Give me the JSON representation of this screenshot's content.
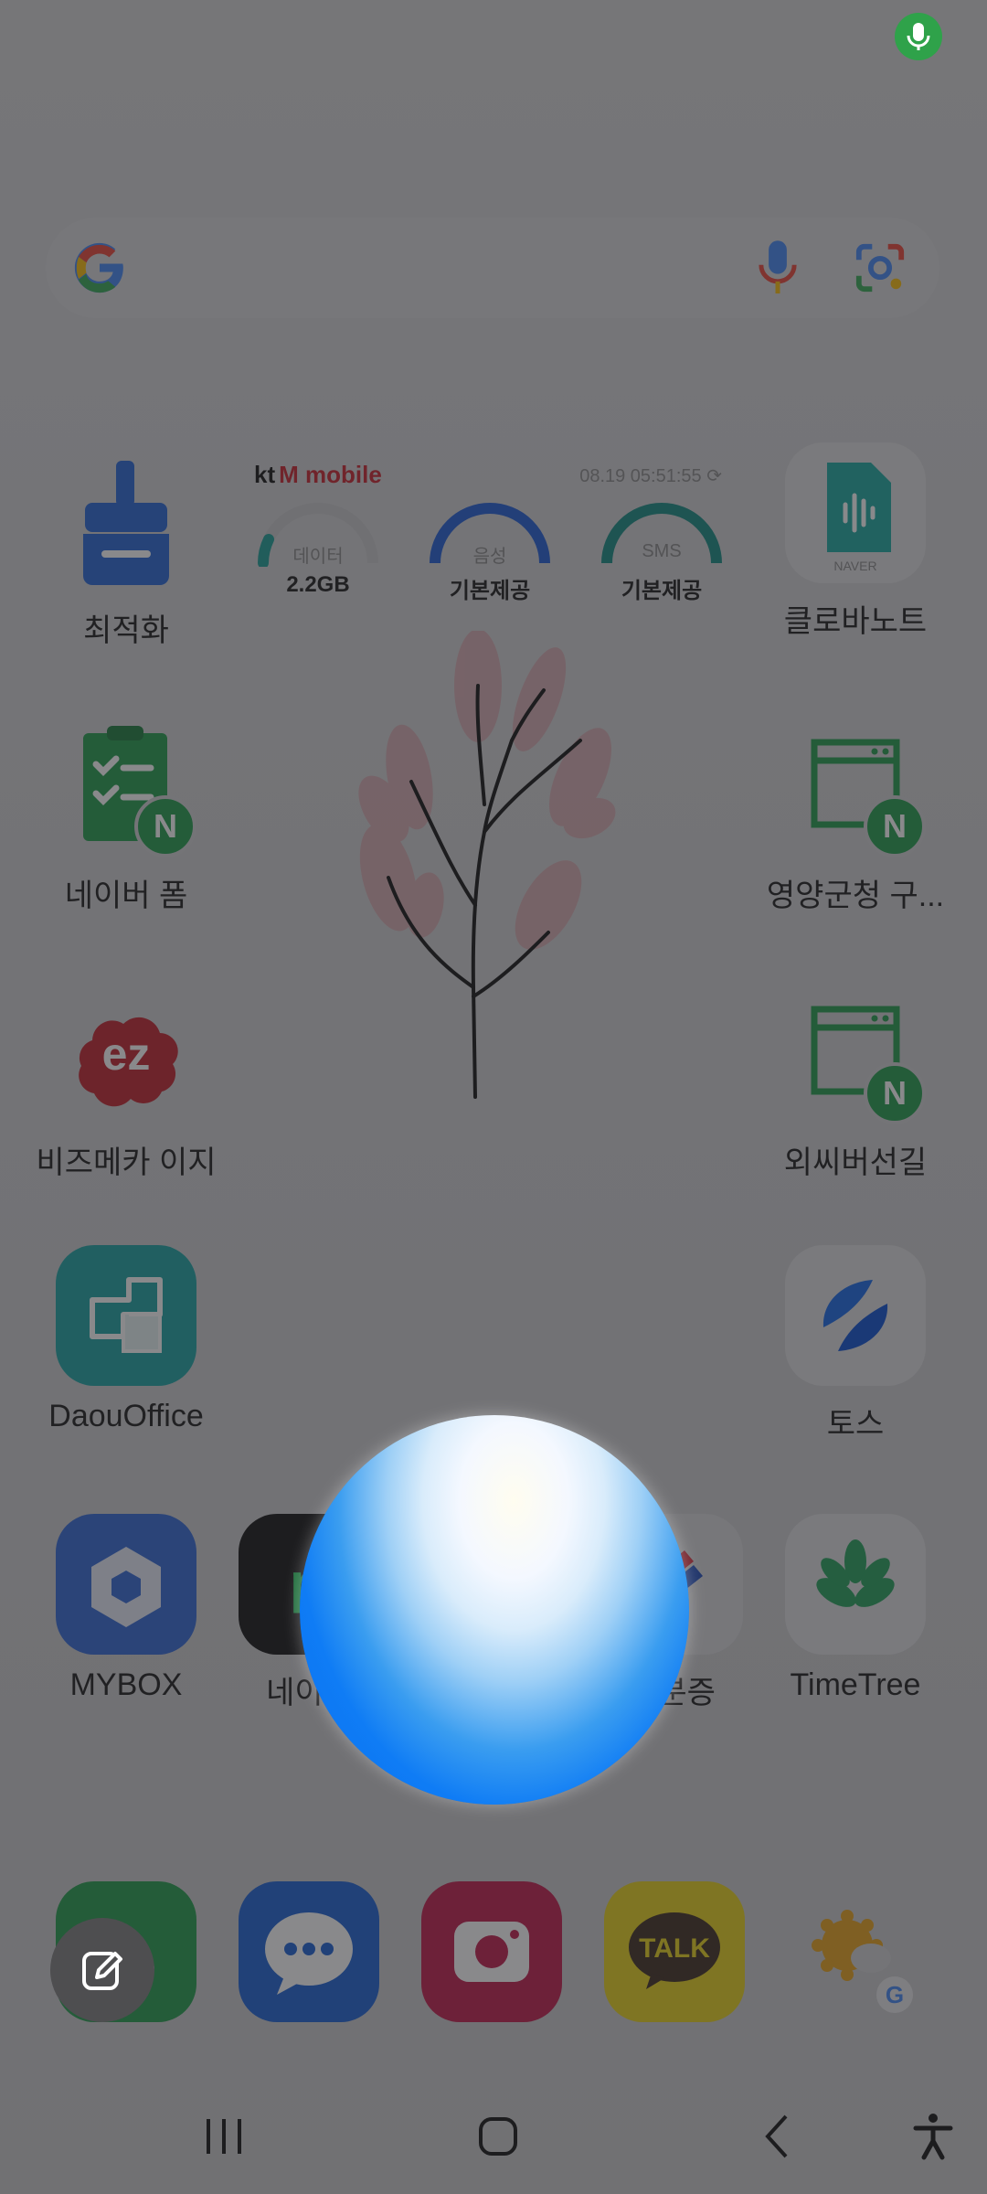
{
  "status_bar": {
    "mic_indicator": "mic-active-icon"
  },
  "search_bar": {
    "logo": "google-logo",
    "mic_icon": "mic-icon",
    "lens_icon": "lens-icon"
  },
  "kt_widget": {
    "brand_kt": "kt",
    "brand_name": "M mobile",
    "timestamp": "08.19 05:51:55",
    "gauges": [
      {
        "caption": "데이터",
        "value": "2.2GB",
        "fill": 0.15,
        "color": "#1a9e96"
      },
      {
        "caption": "음성",
        "value": "기본제공",
        "fill": 1.0,
        "color": "#1e5bd6"
      },
      {
        "caption": "SMS",
        "value": "기본제공",
        "fill": 1.0,
        "color": "#138a80"
      }
    ]
  },
  "apps": [
    {
      "label": "최적화",
      "icon": "broom-icon"
    },
    {
      "label": "클로바노트",
      "icon": "clova-note-icon",
      "sub": "NAVER"
    },
    {
      "label": "네이버 폼",
      "icon": "naver-form-icon"
    },
    {
      "label": "영양군청 구...",
      "icon": "naver-window-icon"
    },
    {
      "label": "비즈메카 이지",
      "icon": "ez-icon",
      "text": "ez"
    },
    {
      "label": "외씨버선길",
      "icon": "naver-window-icon"
    },
    {
      "label": "DaouOffice",
      "icon": "daouoffice-icon"
    },
    {
      "label": "토스",
      "icon": "toss-icon"
    },
    {
      "label": "MYBOX",
      "icon": "mybox-icon"
    },
    {
      "label": "네이버",
      "icon": "naver-pay-icon",
      "text": "p"
    },
    {
      "label": "신분증",
      "icon": "id-card-icon"
    },
    {
      "label": "TimeTree",
      "icon": "timetree-icon"
    }
  ],
  "dock": [
    {
      "icon": "phone-icon"
    },
    {
      "icon": "messages-icon"
    },
    {
      "icon": "camera-icon"
    },
    {
      "icon": "kakaotalk-icon",
      "text": "TALK"
    },
    {
      "icon": "google-weather-icon"
    }
  ],
  "voice_assistant": {
    "orb": "voice-orb",
    "edit_icon": "pencil-edit-icon"
  },
  "navigation": {
    "recents": "recents-icon",
    "home": "home-icon",
    "back": "back-icon",
    "accessibility": "accessibility-icon"
  }
}
